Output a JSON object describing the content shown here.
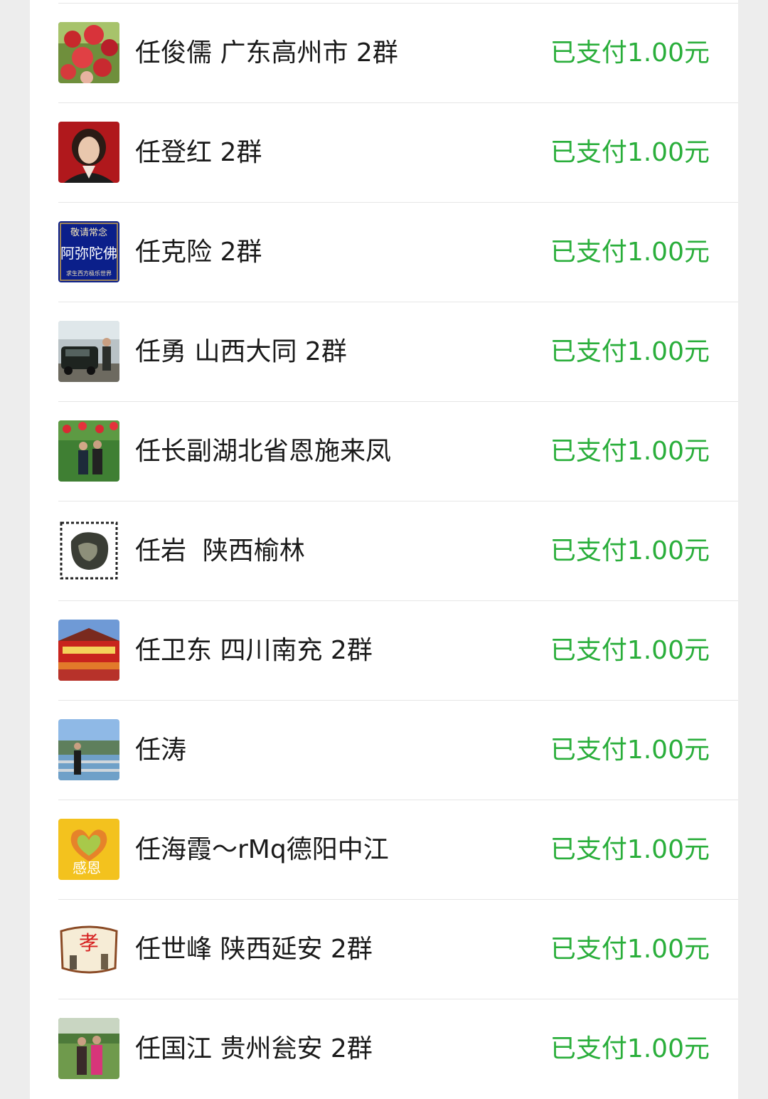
{
  "theme": {
    "status_color": "#2aae3b",
    "name_color": "#1a1a1a"
  },
  "payments": [
    {
      "name": "任俊儒 广东高州市 2群",
      "status": "已支付1.00元",
      "avatar": "apple-tree-photo"
    },
    {
      "name": "任登红 2群",
      "status": "已支付1.00元",
      "avatar": "portrait-photo"
    },
    {
      "name": "任克险 2群",
      "status": "已支付1.00元",
      "avatar": "buddhist-text-card",
      "avatar_text": {
        "top": "敬请常念",
        "main": "阿弥陀佛",
        "bottom": "求生西方极乐世界"
      }
    },
    {
      "name": "任勇 山西大同 2群",
      "status": "已支付1.00元",
      "avatar": "car-and-person-photo"
    },
    {
      "name": "任长副湖北省恩施来凤",
      "status": "已支付1.00元",
      "avatar": "flower-garden-couple-photo"
    },
    {
      "name": "任岩  陕西榆林",
      "status": "已支付1.00元",
      "avatar": "stamp-rock-photo"
    },
    {
      "name": "任卫东 四川南充 2群",
      "status": "已支付1.00元",
      "avatar": "memorial-hall-photo"
    },
    {
      "name": "任涛",
      "status": "已支付1.00元",
      "avatar": "riverside-photo"
    },
    {
      "name": "任海霞～rMq德阳中江",
      "status": "已支付1.00元",
      "avatar": "thanksgiving-hearts-image",
      "avatar_text": {
        "main": "感恩"
      }
    },
    {
      "name": "任世峰 陕西延安 2群",
      "status": "已支付1.00元",
      "avatar": "filial-scroll-image",
      "avatar_text": {
        "main": "孝"
      }
    },
    {
      "name": "任国江 贵州瓮安 2群",
      "status": "已支付1.00元",
      "avatar": "field-couple-photo"
    }
  ]
}
